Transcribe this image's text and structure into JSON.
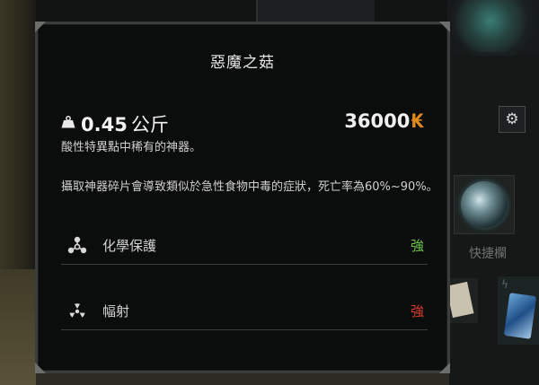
{
  "tooltip": {
    "title": "惡魔之菇",
    "weight_value": "0.45",
    "weight_unit": "公斤",
    "price": "36000",
    "currency_symbol": "₭",
    "subtitle": "酸性特異點中稀有的神器。",
    "description": "攝取神器碎片會導致類似於急性食物中毒的症狀，死亡率為60%~90%。",
    "properties": [
      {
        "label": "化學保護",
        "value": "強",
        "color": "#6cc24a",
        "icon": "biohazard-icon"
      },
      {
        "label": "幅射",
        "value": "強",
        "color": "#d23a2f",
        "icon": "radiation-icon"
      }
    ]
  },
  "background": {
    "quickbar_label": "快捷欄",
    "settings_icon": "gear-icon"
  },
  "colors": {
    "panel_bg": "#0b0c0c",
    "panel_border": "#3b3d3c",
    "currency": "#e08a1e"
  }
}
